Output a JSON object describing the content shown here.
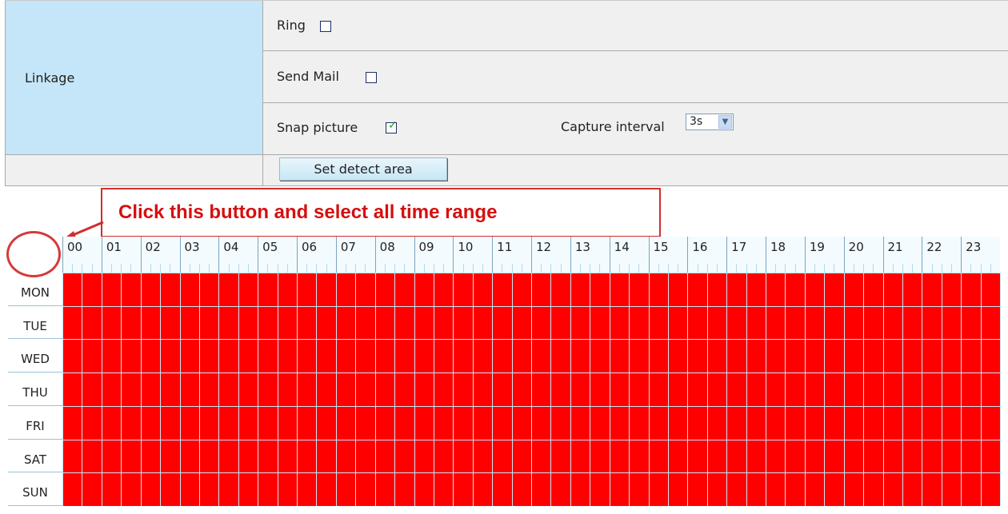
{
  "linkage": {
    "label": "Linkage",
    "ring_label": "Ring",
    "ring_checked": false,
    "send_mail_label": "Send Mail",
    "send_mail_checked": false,
    "snap_picture_label": "Snap picture",
    "snap_picture_checked": true,
    "capture_interval_label": "Capture interval",
    "capture_interval_value": "3s"
  },
  "detect": {
    "button_label": "Set detect area"
  },
  "annotation": {
    "text": "Click this button and select all time range"
  },
  "schedule": {
    "hours": [
      "00",
      "01",
      "02",
      "03",
      "04",
      "05",
      "06",
      "07",
      "08",
      "09",
      "10",
      "11",
      "12",
      "13",
      "14",
      "15",
      "16",
      "17",
      "18",
      "19",
      "20",
      "21",
      "22",
      "23"
    ],
    "days": [
      "MON",
      "TUE",
      "WED",
      "THU",
      "FRI",
      "SAT",
      "SUN"
    ],
    "selected_color": "#ff0000",
    "all_selected": true
  },
  "colors": {
    "label_bg": "#c4e6f8",
    "value_bg": "#f0f0f0",
    "annotation_red": "#d60f0f"
  }
}
